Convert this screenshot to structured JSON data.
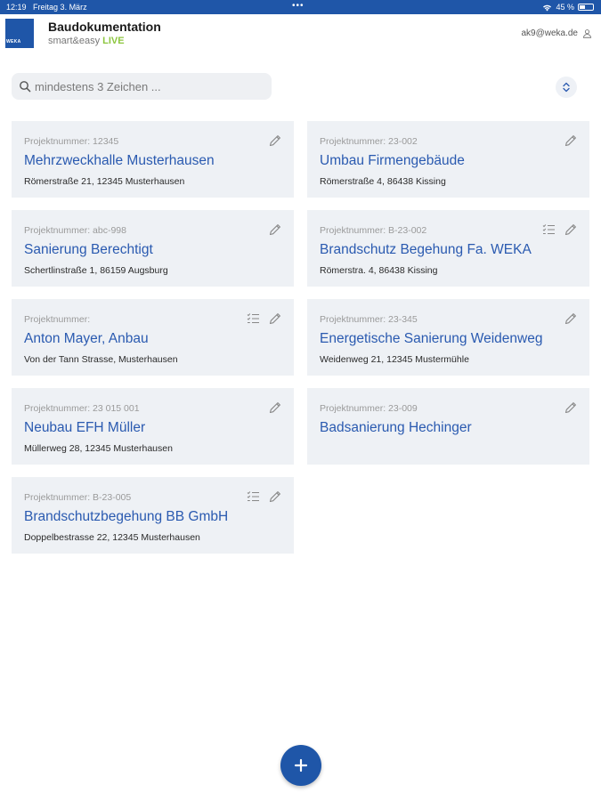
{
  "status": {
    "time": "12:19",
    "date": "Freitag 3. März",
    "battery": "45 %",
    "battery_level": 0.45
  },
  "header": {
    "logo_text": "WEKA",
    "title": "Baudokumentation",
    "subtitle": "smart&easy",
    "subtitle_live": "LIVE",
    "user_email": "ak9@weka.de"
  },
  "search": {
    "placeholder": "mindestens 3 Zeichen ..."
  },
  "projects": [
    {
      "number": "Projektnummer: 12345",
      "title": "Mehrzweckhalle Musterhausen",
      "address": "Römerstraße 21, 12345 Musterhausen"
    },
    {
      "number": "Projektnummer: 23-002",
      "title": "Umbau Firmengebäude",
      "address": "Römerstraße 4, 86438 Kissing"
    },
    {
      "number": "Projektnummer: abc-998",
      "title": "Sanierung Berechtigt",
      "address": "Schertlinstraße 1, 86159 Augsburg"
    },
    {
      "number": "Projektnummer: B-23-002",
      "title": "Brandschutz Begehung Fa. WEKA",
      "address": "Römerstra. 4, 86438 Kissing"
    },
    {
      "number": "Projektnummer:",
      "title": "Anton Mayer, Anbau",
      "address": "Von der Tann Strasse, Musterhausen"
    },
    {
      "number": "Projektnummer: 23-345",
      "title": "Energetische Sanierung Weidenweg",
      "address": "Weidenweg 21, 12345 Mustermühle"
    },
    {
      "number": "Projektnummer: 23 015 001",
      "title": "Neubau EFH Müller",
      "address": "Müllerweg 28, 12345 Musterhausen"
    },
    {
      "number": "Projektnummer: 23-009",
      "title": "Badsanierung Hechinger",
      "address": ""
    },
    {
      "number": "Projektnummer: B-23-005",
      "title": "Brandschutzbegehung BB GmbH",
      "address": "Doppelbestrasse 22, 12345 Musterhausen"
    }
  ],
  "colors": {
    "brand": "#1f56a8",
    "link": "#2a5ab0",
    "live": "#8dc63f",
    "card_bg": "#eef1f5"
  },
  "icons": {
    "edit": "pencil-icon",
    "checklist": "checklist-icon",
    "search": "search-icon",
    "sort": "sort-icon",
    "user": "user-icon",
    "add": "plus-icon"
  }
}
